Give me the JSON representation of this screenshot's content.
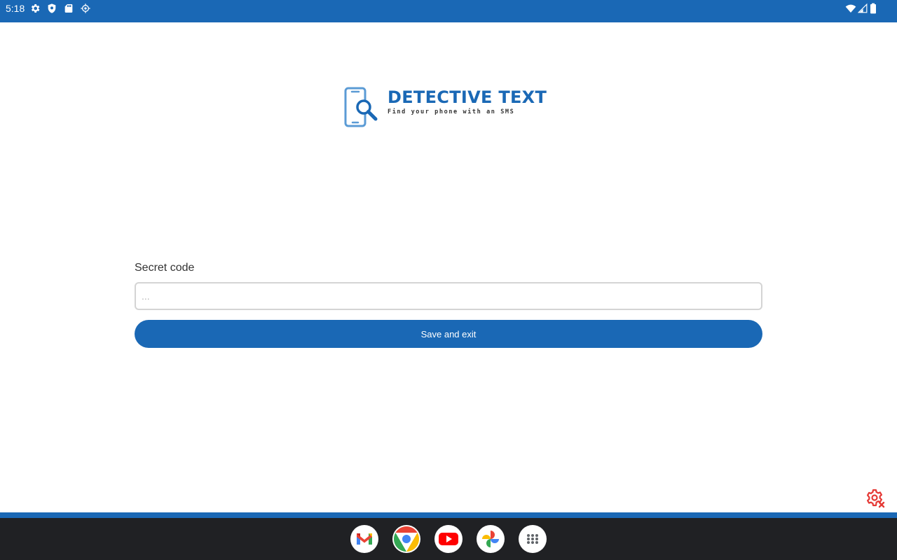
{
  "status_bar": {
    "time": "5:18",
    "left_icons": [
      "gear-icon",
      "shield-icon",
      "sd-card-icon",
      "gps-icon"
    ],
    "right_icons": [
      "wifi-icon",
      "signal-icon",
      "battery-icon"
    ]
  },
  "app": {
    "logo": {
      "title": "DETECTIVE TEXT",
      "tagline": "Find your phone with an SMS"
    },
    "form": {
      "label": "Secret code",
      "input_value": "",
      "input_placeholder": "...",
      "submit_label": "Save and exit"
    },
    "corner_icon": "settings-error-icon"
  },
  "taskbar": {
    "apps": [
      "gmail-icon",
      "chrome-icon",
      "youtube-icon",
      "photos-icon",
      "app-drawer-icon"
    ]
  },
  "colors": {
    "primary": "#1a68b5",
    "taskbar": "#202124",
    "error": "#e53935"
  }
}
